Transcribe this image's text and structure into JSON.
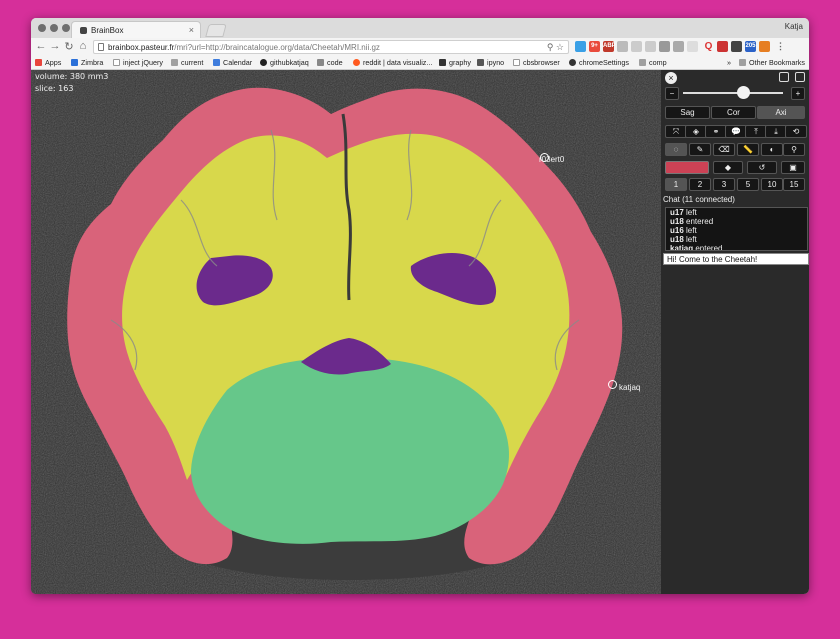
{
  "browser": {
    "tab_title": "BrainBox",
    "user_name": "Katja",
    "url_host": "brainbox.pasteur.fr",
    "url_path": "/mri?url=http://braincatalogue.org/data/Cheetah/MRI.nii.gz",
    "extension_badges": [
      "9+",
      "ABP",
      "205"
    ]
  },
  "bookmarks": {
    "items": [
      {
        "label": "Apps",
        "icon": "apps-icon",
        "color": "#e8453c"
      },
      {
        "label": "Zimbra",
        "icon": "zimbra-icon",
        "color": "#2b70d8"
      },
      {
        "label": "inject jQuery",
        "icon": "page-icon",
        "color": "#ffffff"
      },
      {
        "label": "current",
        "icon": "folder-icon",
        "color": "#a0a0a0"
      },
      {
        "label": "Calendar",
        "icon": "calendar-icon",
        "color": "#3f7ddd"
      },
      {
        "label": "githubkatjaq",
        "icon": "github-icon",
        "color": "#222222"
      },
      {
        "label": "code",
        "icon": "doc-icon",
        "color": "#888888"
      },
      {
        "label": "reddit | data visualiz...",
        "icon": "reddit-icon",
        "color": "#ff5a1f"
      },
      {
        "label": "graphy",
        "icon": "asterisk-icon",
        "color": "#333333"
      },
      {
        "label": "ipyno",
        "icon": "ipython-icon",
        "color": "#555555"
      },
      {
        "label": "cbsbrowser",
        "icon": "page-icon",
        "color": "#ffffff"
      },
      {
        "label": "chromeSettings",
        "icon": "gear-icon",
        "color": "#333333"
      },
      {
        "label": "comp",
        "icon": "folder-icon",
        "color": "#a0a0a0"
      }
    ],
    "overflow": "»",
    "other": "Other Bookmarks"
  },
  "viewer": {
    "volume": "volume: 380 mm3",
    "slice": "slice: 163",
    "cursors": [
      {
        "label": "r03ert0"
      },
      {
        "label": "katjaq"
      }
    ],
    "colors": {
      "cortex": "#d9637a",
      "white_matter": "#d8d84b",
      "ventricle": "#6b2a8c",
      "midbrain": "#66c78a",
      "background": "#2e2e2e"
    }
  },
  "panel": {
    "minus": "−",
    "plus": "+",
    "slider_fraction": 0.6,
    "views": [
      {
        "label": "Sag",
        "active": false
      },
      {
        "label": "Cor",
        "active": false
      },
      {
        "label": "Axi",
        "active": true
      }
    ],
    "tools_row1": [
      {
        "icon": "fullscreen-icon",
        "glyph": "⤧"
      },
      {
        "icon": "3d-cube-icon",
        "glyph": "◈"
      },
      {
        "icon": "link-icon",
        "glyph": "⚭"
      },
      {
        "icon": "chat-icon",
        "glyph": "💬"
      },
      {
        "icon": "upload-icon",
        "glyph": "⤒"
      },
      {
        "icon": "download-icon",
        "glyph": "⤓"
      },
      {
        "icon": "undo-circle-icon",
        "glyph": "⟲"
      }
    ],
    "tools_row2": [
      {
        "icon": "crosshair-icon",
        "glyph": "◌",
        "active": true
      },
      {
        "icon": "pencil-icon",
        "glyph": "✎"
      },
      {
        "icon": "eraser-icon",
        "glyph": "⌫"
      },
      {
        "icon": "ruler-icon",
        "glyph": "📏"
      },
      {
        "icon": "contrast-icon",
        "glyph": "◐"
      },
      {
        "icon": "eyedropper-icon",
        "glyph": "⚲"
      }
    ],
    "tools_row3": [
      {
        "icon": "fill-icon",
        "glyph": "◆"
      },
      {
        "icon": "redo-icon",
        "glyph": "↺"
      },
      {
        "icon": "save-icon",
        "glyph": "▣"
      }
    ],
    "label_color": "#cc4255",
    "brush_sizes": [
      "1",
      "2",
      "3",
      "5",
      "10",
      "15"
    ],
    "chat_header": "Chat (11 connected)",
    "chat_lines": [
      {
        "user": "u17",
        "text": " left"
      },
      {
        "user": "u18",
        "text": " entered"
      },
      {
        "user": "u16",
        "text": " left"
      },
      {
        "user": "u18",
        "text": " left"
      },
      {
        "user": "katjaq",
        "text": " entered"
      }
    ],
    "chat_input": "Hi! Come to the Cheetah!"
  }
}
